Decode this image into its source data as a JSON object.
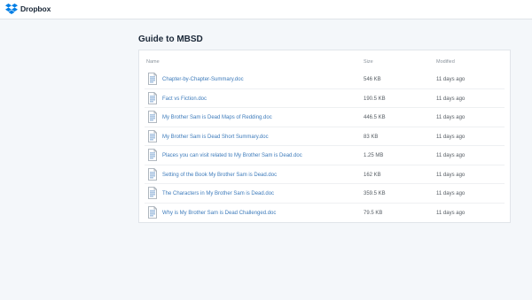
{
  "app": {
    "name": "Dropbox",
    "icon": "dropbox-logo-icon",
    "brand_color": "#007ee5"
  },
  "folder": {
    "title": "Guide to MBSD"
  },
  "table": {
    "columns": {
      "name": "Name",
      "size": "Size",
      "modified": "Modified"
    },
    "rows": [
      {
        "name": "Chapter-by-Chapter-Summary.doc",
        "size": "546 KB",
        "modified": "11 days ago",
        "icon": "doc-file-icon"
      },
      {
        "name": "Fact vs Fiction.doc",
        "size": "190.5 KB",
        "modified": "11 days ago",
        "icon": "doc-file-icon"
      },
      {
        "name": "My Brother Sam is Dead Maps of Redding.doc",
        "size": "446.5 KB",
        "modified": "11 days ago",
        "icon": "doc-file-icon"
      },
      {
        "name": "My Brother Sam is Dead Short Summary.doc",
        "size": "83 KB",
        "modified": "11 days ago",
        "icon": "doc-file-icon"
      },
      {
        "name": "Places you can visit related to My Brother Sam is Dead.doc",
        "size": "1.25 MB",
        "modified": "11 days ago",
        "icon": "doc-file-icon"
      },
      {
        "name": "Setting of the Book My Brother Sam is Dead.doc",
        "size": "162 KB",
        "modified": "11 days ago",
        "icon": "doc-file-icon"
      },
      {
        "name": "The Characters in My Brother Sam is Dead.doc",
        "size": "359.5 KB",
        "modified": "11 days ago",
        "icon": "doc-file-icon"
      },
      {
        "name": "Why is My Brother Sam is Dead Challenged.doc",
        "size": "79.5 KB",
        "modified": "11 days ago",
        "icon": "doc-file-icon"
      }
    ]
  }
}
